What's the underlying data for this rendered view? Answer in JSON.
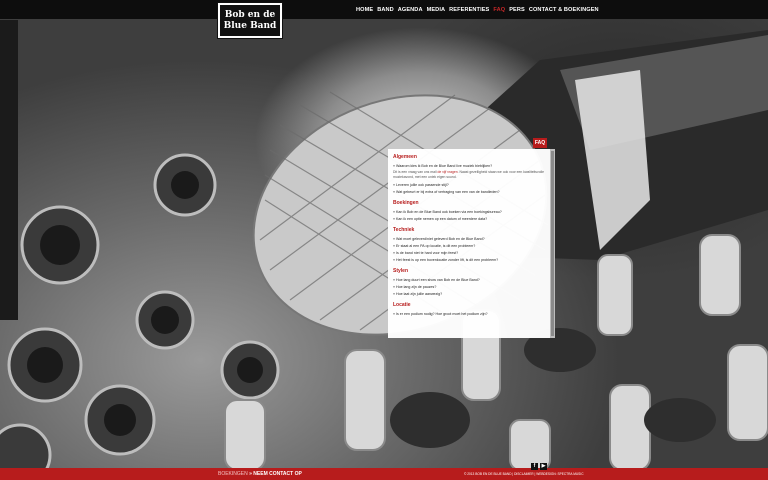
{
  "logo": {
    "line1": "Bob en de",
    "line2": "Blue Band"
  },
  "nav": [
    {
      "label": "HOME",
      "active": false
    },
    {
      "label": "BAND",
      "active": false
    },
    {
      "label": "AGENDA",
      "active": false
    },
    {
      "label": "MEDIA",
      "active": false
    },
    {
      "label": "REFERENTIES",
      "active": false
    },
    {
      "label": "FAQ",
      "active": true
    },
    {
      "label": "PERS",
      "active": false
    },
    {
      "label": "CONTACT & BOEKINGEN",
      "active": false
    }
  ],
  "faq": {
    "tab_label": "FAQ",
    "sections": [
      {
        "title": "Algemeen",
        "items": [
          {
            "q": "» Waarom kies ik Bob en de Blue Band live muziek bieblijken?",
            "a_before": "Dit is een vraag van ons mail ",
            "a_link": "de vijf vragen",
            "a_after": ". Naast gezelligheid staan we ook voor een kwaliteitsvolle muziekavond, met een uniek eigen sound."
          },
          {
            "q": "» Leveren jullie ook passende stijl?"
          },
          {
            "q": "» Wat gebeurt er bij extra of vertraging van een van de bandleden?"
          }
        ]
      },
      {
        "title": "Boekingen",
        "items": [
          {
            "q": "» Kan ik Bob en de Blue Band ook boeken via een boekingsbureau?"
          },
          {
            "q": "» Kan ik een optie nemen op een datum of meerdere data?"
          }
        ]
      },
      {
        "title": "Techniek",
        "items": [
          {
            "q": "» Wat moet geleverd/niet geleverd Bob en de Blue Band?"
          },
          {
            "q": "» Er staat al een PA op locatie, is dit een probleem?"
          },
          {
            "q": "» Is de band niet te hard voor mijn feest?"
          },
          {
            "q": "» Het feest is op een bovenlocatie zonder lift, is dit een probleem?"
          }
        ]
      },
      {
        "title": "Stylen",
        "items": [
          {
            "q": "» Hoe lang duurt een show van Bob en de Blue Band?"
          },
          {
            "q": "» Hoe lang zijn de pauzes?"
          },
          {
            "q": "» Hoe laat zijn jullie aanwezig?"
          }
        ]
      },
      {
        "title": "Locatie",
        "items": [
          {
            "q": "» Is er een podium nodig? Hoe groot moet het podium zijn?"
          }
        ]
      }
    ]
  },
  "footer": {
    "contact_prefix": "BOEKINGEN",
    "contact_cta": "» NEEM CONTACT OP",
    "copyright": "© 2013 BOB EN DE BLUE BAND  |  DISCLAIMER  |  WEBDESIGN: SPECTRA MUSIC"
  },
  "social": {
    "facebook": "f",
    "youtube": "▶"
  },
  "colors": {
    "accent": "#b71c1c",
    "topbar": "#0d0d0d"
  }
}
